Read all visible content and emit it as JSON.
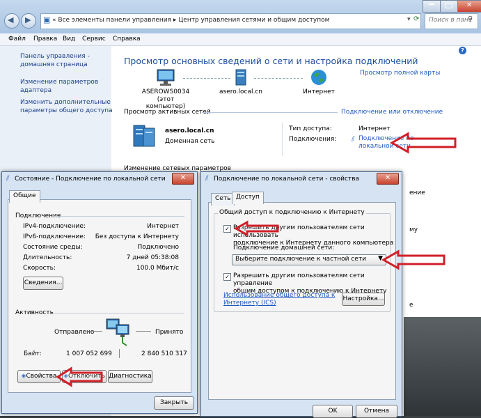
{
  "control_panel": {
    "breadcrumb_prefix": "«",
    "breadcrumb_1": "Все элементы панели управления",
    "breadcrumb_sep": "▸",
    "breadcrumb_2": "Центр управления сетями и общим доступом",
    "search_placeholder": "Поиск в пане",
    "menu": [
      "Файл",
      "Правка",
      "Вид",
      "Сервис",
      "Справка"
    ],
    "sidebar": [
      [
        "Панель управления -",
        "домашняя страница"
      ],
      [
        "Изменение параметров",
        "адаптера"
      ],
      [
        "Изменить дополнительные",
        "параметры общего доступа"
      ]
    ],
    "main_title": "Просмотр основных сведений о сети и настройка подключений",
    "full_map_link": "Просмотр полной карты",
    "map": {
      "computer_name": "ASEROWS0034",
      "computer_sub": "(этот компьютер)",
      "domain_name": "asero.local.cn",
      "internet_label": "Интернет"
    },
    "active_networks_title": "Просмотр активных сетей",
    "connect_disconnect_link": "Подключение или отключение",
    "network": {
      "name": "asero.local.cn",
      "type": "Доменная сеть",
      "access_label": "Тип доступа:",
      "access_value": "Интернет",
      "connections_label": "Подключения:",
      "connection_link_1": "Подключение по",
      "connection_link_2": "локальной сети"
    },
    "change_settings_title": "Изменение сетевых параметров",
    "clipped_right_text": [
      "ение",
      "му",
      "е"
    ]
  },
  "status_dialog": {
    "title": "Состояние - Подключение по локальной сети",
    "tab": "Общие",
    "connection_group": "Подключение",
    "rows": [
      {
        "label": "IPv4-подключение:",
        "value": "Интернет"
      },
      {
        "label": "IPv6-подключение:",
        "value": "Без доступа к Интернету"
      },
      {
        "label": "Состояние среды:",
        "value": "Подключено"
      },
      {
        "label": "Длительность:",
        "value": "7 дней 05:38:08"
      },
      {
        "label": "Скорость:",
        "value": "100.0 Мбит/с"
      }
    ],
    "details_button": "Сведения...",
    "activity_group": "Активность",
    "sent_label": "Отправлено",
    "received_label": "Принято",
    "bytes_label": "Байт:",
    "bytes_sent": "1 007 052 699",
    "bytes_received": "2 840 510 317",
    "properties_button": "Свойства",
    "disable_button": "Отключить",
    "diagnostics_button": "Диагностика",
    "close_button": "Закрыть"
  },
  "properties_dialog": {
    "title": "Подключение по локальной сети - свойства",
    "tabs": [
      "Сеть",
      "Доступ"
    ],
    "group_title": "Общий доступ к подключению к Интернету",
    "allow_share_text_1": "Разрешить другим пользователям сети использовать",
    "allow_share_text_2": "подключение к Интернету данного компьютера",
    "home_network_label": "Подключение домашней сети:",
    "home_network_value": "Выберите подключение к частной сети",
    "allow_control_text_1": "Разрешить другим пользователям сети управление",
    "allow_control_text_2": "общим доступом к подключению к Интернету",
    "ics_link_1": "Использование общего доступа к",
    "ics_link_2": "Интернету (ICS)",
    "settings_button": "Настройка...",
    "ok_button": "OK",
    "cancel_button": "Отмена"
  },
  "colors": {
    "annotation_arrow": "#d11f28",
    "link": "#1c58c5",
    "title_blue": "#1d4e9e"
  }
}
